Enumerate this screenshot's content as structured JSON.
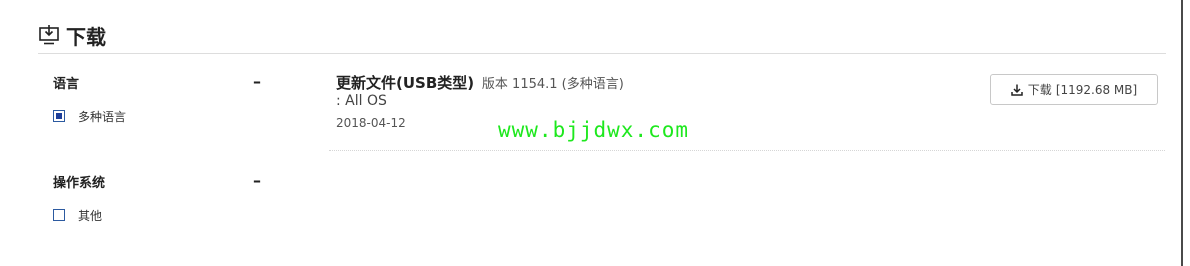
{
  "header": {
    "title": "下载",
    "icon": "download-monitor-icon"
  },
  "filters": [
    {
      "title": "语言",
      "toggle": "–",
      "options": [
        {
          "label": "多种语言",
          "checked": true
        }
      ]
    },
    {
      "title": "操作系统",
      "toggle": "–",
      "options": [
        {
          "label": "其他",
          "checked": false
        }
      ]
    }
  ],
  "result": {
    "title": "更新文件(USB类型)",
    "version": "版本 1154.1 (多种语言)",
    "os": ": All OS",
    "date": "2018-04-12",
    "download_label": "下载",
    "download_size": "[1192.68 MB]"
  },
  "watermark": "www.bjjdwx.com",
  "colors": {
    "checkbox": "#1e3f9a",
    "watermark": "#1ee81e"
  }
}
